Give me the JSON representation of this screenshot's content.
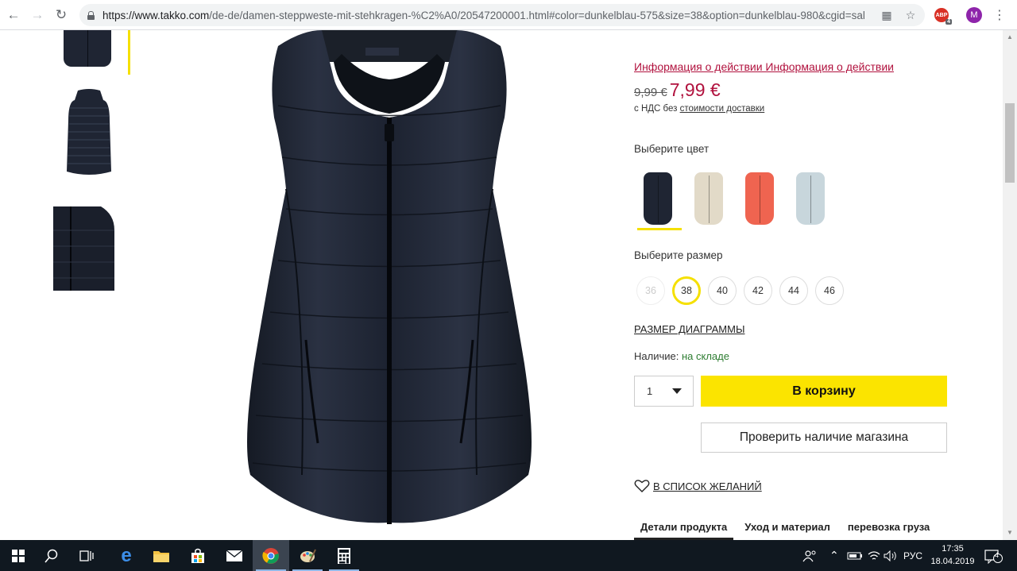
{
  "browser": {
    "url_host": "https://www.takko.com",
    "url_path": "/de-de/damen-steppweste-mit-stehkragen-%C2%A0/20547200001.html#color=dunkelblau-575&size=38&option=dunkelblau-980&cgid=sal...",
    "extension_badge": "ABP",
    "extension_count": "4",
    "profile_initial": "M"
  },
  "product": {
    "promo_link": "Информация о действии Информация о действии",
    "old_price": "9,99 €",
    "new_price": "7,99 €",
    "vat_prefix": "с НДС без ",
    "vat_link": "стоимости доставки",
    "color_label": "Выберите цвет",
    "colors": [
      {
        "name": "dunkelblau",
        "hex": "#1f2533",
        "selected": true
      },
      {
        "name": "beige",
        "hex": "#e2dac8",
        "selected": false
      },
      {
        "name": "coral",
        "hex": "#ef6450",
        "selected": false
      },
      {
        "name": "light-blue",
        "hex": "#c8d6dc",
        "selected": false
      }
    ],
    "size_label": "Выберите размер",
    "sizes": [
      "36",
      "38",
      "40",
      "42",
      "44",
      "46"
    ],
    "selected_size": "38",
    "disabled_sizes": [
      "36"
    ],
    "size_chart": "РАЗМЕР ДИАГРАММЫ",
    "availability_label": "Наличие:",
    "availability_value": "на складе",
    "quantity": "1",
    "add_to_cart": "В корзину",
    "check_store": "Проверить наличие магазина",
    "wishlist": "В СПИСОК ЖЕЛАНИЙ",
    "tabs": [
      "Детали продукта",
      "Уход и материал",
      "перевозка груза"
    ]
  },
  "taskbar": {
    "language": "РУС",
    "time": "17:35",
    "date": "18.04.2019",
    "notifications": "4"
  }
}
